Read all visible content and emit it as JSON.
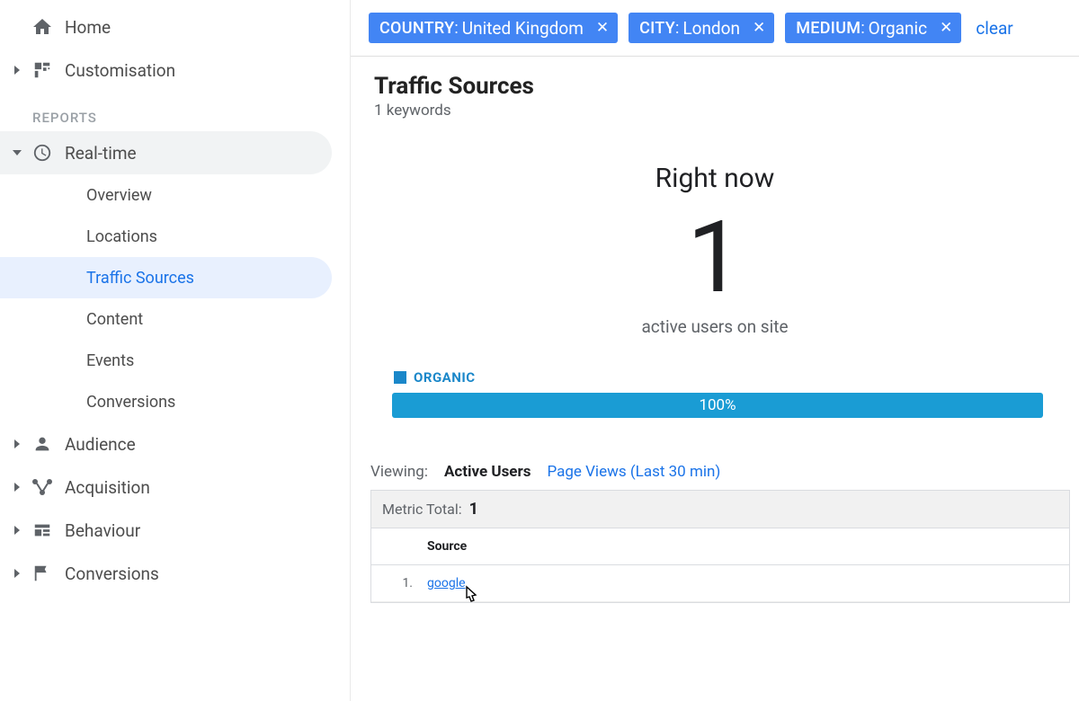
{
  "sidebar": {
    "home": "Home",
    "customisation": "Customisation",
    "reports_label": "REPORTS",
    "realtime": "Real-time",
    "realtime_items": [
      "Overview",
      "Locations",
      "Traffic Sources",
      "Content",
      "Events",
      "Conversions"
    ],
    "realtime_active_index": 2,
    "audience": "Audience",
    "acquisition": "Acquisition",
    "behaviour": "Behaviour",
    "conversions": "Conversions"
  },
  "chips": {
    "items": [
      {
        "key": "COUNTRY",
        "value": "United Kingdom"
      },
      {
        "key": "CITY",
        "value": "London"
      },
      {
        "key": "MEDIUM",
        "value": "Organic"
      }
    ],
    "clear": "clear"
  },
  "header": {
    "title": "Traffic Sources",
    "subtitle": "1 keywords"
  },
  "rightnow": {
    "top": "Right now",
    "value": "1",
    "bottom": "active users on site"
  },
  "breakdown": {
    "legend": "ORGANIC",
    "bar_label": "100%"
  },
  "viewing": {
    "label": "Viewing:",
    "active": "Active Users",
    "other": "Page Views (Last 30 min)"
  },
  "table": {
    "metric_total_label": "Metric Total:",
    "metric_total_value": "1",
    "col_source": "Source",
    "rows": [
      {
        "index": "1.",
        "source": "google"
      }
    ]
  }
}
